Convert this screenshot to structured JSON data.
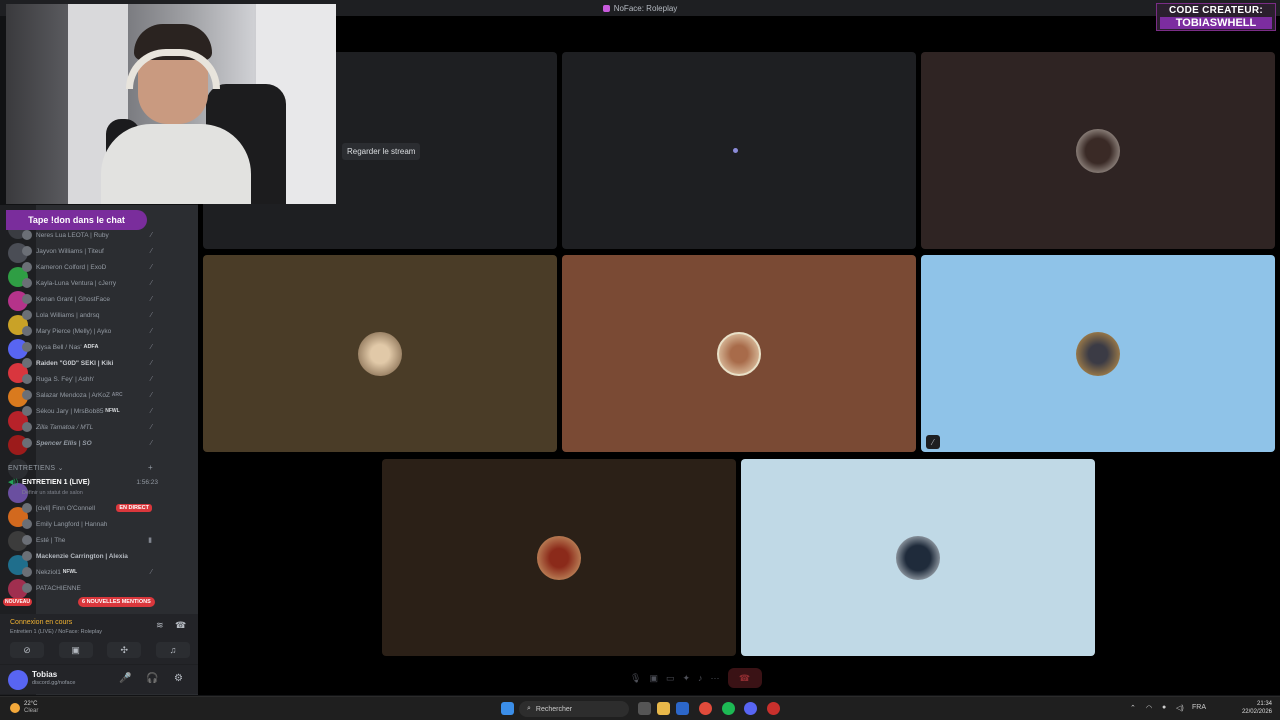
{
  "window": {
    "title": "NoFace: Roleplay"
  },
  "overlay": {
    "creator_line1": "CODE CREATEUR:",
    "creator_line2": "TOBIASWHELL",
    "chat_prompt": "Tape !don dans le chat"
  },
  "members": [
    "Neres Lua LEOTA | Ruby",
    "Jayvon Williams | Titeuf",
    "Kameron Colford | ExoD",
    "Kayla-Luna Ventura | cJerry",
    "Kenan Grant | GhostFace",
    "Lola Williams | andrsq",
    "Mary Pierce (Melly) | Ayko",
    "Nysa Bell / Nas'",
    "Raiden \"G0D\" SEKI | Kiki",
    "Ruga S. Fey' | Ashh'",
    "Salazar Mendoza | ArKoZ",
    "Sékou Jary | MrsBob85",
    "Zilla Tamatoa / MTL",
    "Spencer Ellis | SO"
  ],
  "member_tags": [
    "",
    "",
    "",
    "",
    "",
    "",
    "",
    "ADFA",
    "",
    "",
    "ARC",
    "NFWL",
    "",
    ""
  ],
  "category": {
    "label": "ENTRETIENS"
  },
  "voice_channel": {
    "name": "ENTRETIEN 1 (LIVE)",
    "timer": "1:56:23",
    "subtitle": "Définir un statut de salon"
  },
  "voice_members": [
    {
      "name": "[civil] Finn O'Connell",
      "badge": "EN DIRECT"
    },
    {
      "name": "Emily Langford | Hannah",
      "badge": ""
    },
    {
      "name": "Esté | The",
      "badge": ""
    },
    {
      "name": "Mackenzie Carrington | Alexia",
      "badge": ""
    },
    {
      "name": "Nekziol1",
      "badge": "NFWL"
    },
    {
      "name": "PATACHIENNE",
      "badge": ""
    }
  ],
  "notifications": {
    "mentions": "6 NOUVELLES MENTIONS",
    "new": "NOUVEAU"
  },
  "connection": {
    "status": "Connexion en cours",
    "detail": "Entretien 1 (LIVE) / NoFace: Roleplay"
  },
  "user": {
    "name": "Tobias",
    "status": "discord.gg/noface"
  },
  "stage": {
    "watch_label": "Regarder le stream"
  },
  "taskbar": {
    "temperature": "22°C",
    "weather": "Clear",
    "search_placeholder": "Rechercher",
    "lang": "FRA",
    "time": "21:34",
    "date": "22/02/2026"
  },
  "icons": [
    "mic-off-icon",
    "headphones-icon",
    "gear-icon",
    "camera-icon",
    "screen-share-icon",
    "activities-icon",
    "soundboard-icon",
    "hang-up-icon",
    "search-icon",
    "windows-icon"
  ],
  "colors": {
    "accent": "#7c2da0",
    "danger": "#da373c",
    "connecting": "#f0b232"
  }
}
